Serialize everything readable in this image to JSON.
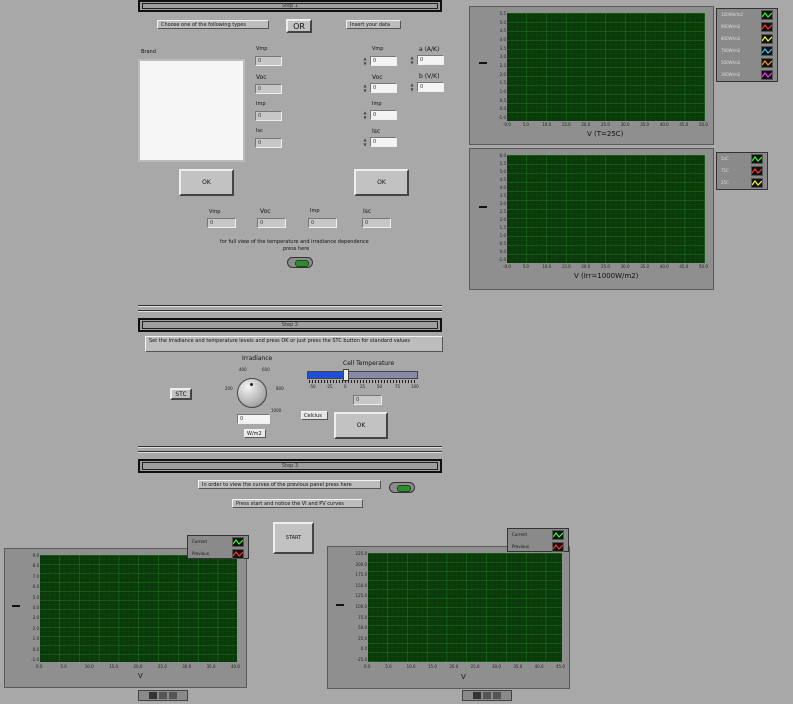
{
  "step1": {
    "banner": "Step 1",
    "choose_label": "Choose one of the following types",
    "or_label": "OR",
    "insert_label": "Insert your data",
    "brand_label": "Brand",
    "left_fields": [
      {
        "label": "Vmp",
        "value": "0"
      },
      {
        "label": "Voc",
        "value": "0"
      },
      {
        "label": "Imp",
        "value": "0"
      },
      {
        "label": "Isc",
        "value": "0"
      }
    ],
    "right_fields": [
      {
        "label": "Vmp",
        "value": "0"
      },
      {
        "label": "Voc",
        "value": "0"
      },
      {
        "label": "Imp",
        "value": "0"
      },
      {
        "label": "Isc",
        "value": "0"
      }
    ],
    "coef_fields": [
      {
        "label": "a (A/K)",
        "value": "0"
      },
      {
        "label": "b (V/K)",
        "value": "0"
      }
    ],
    "ok_left": "OK",
    "ok_right": "OK",
    "result_fields": [
      {
        "label": "Vmp",
        "value": "0"
      },
      {
        "label": "Voc",
        "value": "0"
      },
      {
        "label": "Imp",
        "value": "0"
      },
      {
        "label": "Isc",
        "value": "0"
      }
    ],
    "full_view_text_1": "for full view of the  temperature and irradiance dependence",
    "full_view_text_2": "press here"
  },
  "step2": {
    "banner": "Step 2",
    "instruction": "Set the irradiance and temperature levels and press OK or just press the STC button for standard values",
    "irradiance_label": "Irradiance",
    "knob_ticks": [
      "200",
      "400",
      "600",
      "800",
      "1000"
    ],
    "irradiance_value": "0",
    "irradiance_unit": "W/m2",
    "stc_label": "STC",
    "cell_temp_label": "Cell Temperature",
    "slider_ticks": [
      "-50",
      "-25",
      "0",
      "25",
      "50",
      "75",
      "100"
    ],
    "slider_level_fraction": 0.33,
    "temp_value": "0",
    "celsius_label": "Celcius",
    "ok_label": "OK"
  },
  "step3": {
    "banner": "Step 3",
    "previous_text": "In order to view the curves of the previous panel press here",
    "start_text": "Press start and notice the VI and PV curves",
    "start_label": "START"
  },
  "graphs": {
    "top_right_1": {
      "xlabel": "V (T=25C)",
      "yticks": [
        "5.5",
        "5.0",
        "4.5",
        "4.0",
        "3.5",
        "3.0",
        "2.5",
        "2.0",
        "1.5",
        "1.0",
        "0.5",
        "0.0",
        "-1.0"
      ],
      "xticks": [
        "-0.0",
        "5.0",
        "10.0",
        "15.0",
        "20.0",
        "25.0",
        "30.0",
        "35.0",
        "40.0",
        "45.0",
        "50.0"
      ],
      "legend": [
        {
          "name": "1000W/m2",
          "color": "#33ff33"
        },
        {
          "name": "900W/m2",
          "color": "#ff3333"
        },
        {
          "name": "800W/m2",
          "color": "#ffff33"
        },
        {
          "name": "700W/m2",
          "color": "#33ccff"
        },
        {
          "name": "500W/m2",
          "color": "#ff9933"
        },
        {
          "name": "300W/m2",
          "color": "#ff33ff"
        }
      ]
    },
    "top_right_2": {
      "xlabel": "V (Irr=1000W/m2)",
      "yticks": [
        "6.0",
        "5.5",
        "5.0",
        "4.5",
        "4.0",
        "3.5",
        "3.0",
        "2.5",
        "2.0",
        "1.5",
        "1.0",
        "0.5",
        "0.0",
        "-1.0"
      ],
      "xticks": [
        "-0.0",
        "5.0",
        "10.0",
        "15.0",
        "20.0",
        "25.0",
        "30.0",
        "35.0",
        "40.0",
        "45.0",
        "50.0"
      ],
      "legend": [
        {
          "name": "5oC",
          "color": "#33ff33"
        },
        {
          "name": "75C",
          "color": "#ff3333"
        },
        {
          "name": "25C",
          "color": "#ffff33"
        }
      ]
    },
    "bottom_left": {
      "xlabel": "V",
      "yticks": [
        "9.0",
        "8.0",
        "7.0",
        "6.0",
        "5.0",
        "4.0",
        "3.0",
        "2.0",
        "1.0",
        "0.0",
        "-1.0"
      ],
      "xticks": [
        "0.0",
        "5.0",
        "10.0",
        "15.0",
        "20.0",
        "25.0",
        "30.0",
        "35.0",
        "40.0"
      ],
      "legend": [
        {
          "name": "Current",
          "color": "#33ff33"
        },
        {
          "name": "Previous",
          "color": "#ff3333"
        }
      ]
    },
    "bottom_right": {
      "xlabel": "V",
      "yticks": [
        "225.0",
        "200.0",
        "175.0",
        "150.0",
        "125.0",
        "100.0",
        "75.0",
        "50.0",
        "25.0",
        "0.0",
        "-25.0"
      ],
      "xticks": [
        "0.0",
        "5.0",
        "10.0",
        "15.0",
        "20.0",
        "25.0",
        "30.0",
        "35.0",
        "40.0",
        "45.0"
      ],
      "legend": [
        {
          "name": "Current",
          "color": "#33ff33"
        },
        {
          "name": "Previous",
          "color": "#ff3333"
        }
      ]
    }
  }
}
